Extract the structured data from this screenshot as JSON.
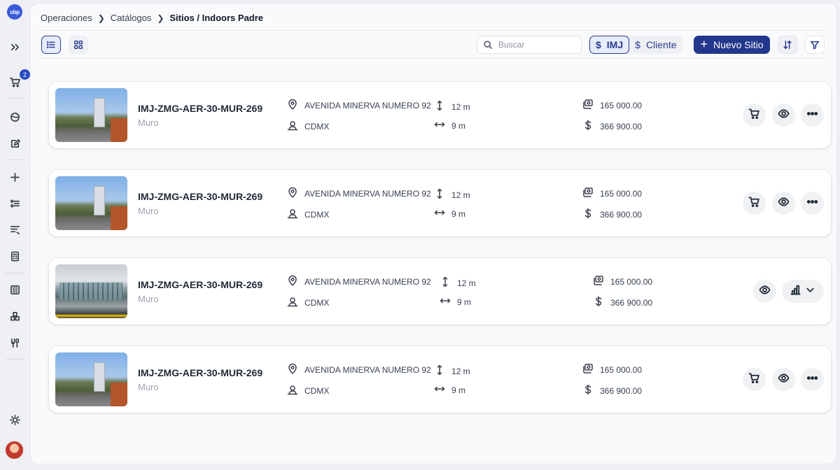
{
  "app": {
    "logo_text": "obp",
    "cart_badge": "2"
  },
  "breadcrumb": {
    "items": [
      "Operaciones",
      "Catálogos"
    ],
    "current": "Sitios / Indoors Padre"
  },
  "toolbar": {
    "search_placeholder": "Buscar",
    "currency_options": [
      {
        "symbol": "$",
        "label": "IMJ",
        "active": true
      },
      {
        "symbol": "$",
        "label": "Cliente",
        "active": false
      }
    ],
    "new_button": {
      "symbol": "+",
      "label": "Nuevo Sitio"
    }
  },
  "sites": [
    {
      "name": "IMJ-ZMG-AER-30-MUR-269",
      "type": "Muro",
      "address": "AVENIDA MINERVA NUMERO 92",
      "city": "CDMX",
      "height": "12 m",
      "width": "9 m",
      "cost": "165 000.00",
      "price": "366 900.00",
      "image": "street",
      "actions": [
        "cart-icon",
        "eye-icon",
        "more-icon"
      ]
    },
    {
      "name": "IMJ-ZMG-AER-30-MUR-269",
      "type": "Muro",
      "address": "AVENIDA MINERVA NUMERO 92",
      "city": "CDMX",
      "height": "12 m",
      "width": "9 m",
      "cost": "165 000.00",
      "price": "366 900.00",
      "image": "street",
      "actions": [
        "cart-icon",
        "eye-icon",
        "more-icon"
      ]
    },
    {
      "name": "IMJ-ZMG-AER-30-MUR-269",
      "type": "Muro",
      "address": "AVENIDA MINERVA NUMERO 92",
      "city": "CDMX",
      "height": "12 m",
      "width": "9 m",
      "cost": "165 000.00",
      "price": "366 900.00",
      "image": "airport",
      "actions": [
        "eye-icon",
        "chart-icon",
        "chevron-down-icon"
      ]
    },
    {
      "name": "IMJ-ZMG-AER-30-MUR-269",
      "type": "Muro",
      "address": "AVENIDA MINERVA NUMERO 92",
      "city": "CDMX",
      "height": "12 m",
      "width": "9 m",
      "cost": "165 000.00",
      "price": "366 900.00",
      "image": "street",
      "actions": [
        "cart-icon",
        "eye-icon",
        "more-icon"
      ]
    }
  ],
  "colors": {
    "primary": "#23378c",
    "accent": "#2a4cc4",
    "badge": "#2a4cc4"
  }
}
